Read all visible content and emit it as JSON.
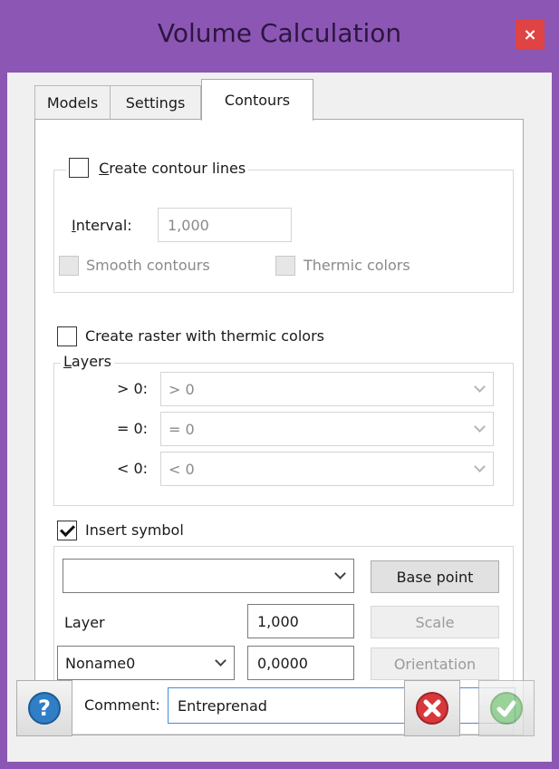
{
  "window": {
    "title": "Volume Calculation",
    "close_label": "×",
    "frame_color": "#8c57b4"
  },
  "tabs": [
    {
      "label": "Models",
      "active": false
    },
    {
      "label": "Settings",
      "active": false
    },
    {
      "label": "Contours",
      "active": true
    }
  ],
  "contour_lines": {
    "checkbox_label_hotkey": "C",
    "checkbox_label_rest": "reate contour lines",
    "checked": false,
    "interval_label_hotkey": "I",
    "interval_label_rest": "nterval:",
    "interval_value": "1,000",
    "smooth_label": "Smooth contours",
    "thermic_label": "Thermic colors"
  },
  "raster": {
    "checkbox_label": "Create raster with thermic colors",
    "checked": false
  },
  "layers": {
    "legend_hotkey": "L",
    "legend_rest": "ayers",
    "rows": [
      {
        "label": "> 0:",
        "value": "> 0"
      },
      {
        "label": "= 0:",
        "value": "= 0"
      },
      {
        "label": "< 0:",
        "value": "< 0"
      }
    ]
  },
  "symbol": {
    "checkbox_label": "Insert symbol",
    "checked": true,
    "symbol_select_value": "",
    "base_point_label": "Base point",
    "layer_label": "Layer",
    "scale_value": "1,000",
    "scale_button": "Scale",
    "layer_select_value": "Noname0",
    "orientation_value": "0,0000",
    "orientation_button": "Orientation",
    "comment_label": "Comment:",
    "comment_value": "Entreprenad"
  },
  "footer": {
    "help_icon": "help-icon",
    "cancel_icon": "cancel-icon",
    "ok_icon": "ok-icon",
    "cancel_color": "#d8383b",
    "ok_color": "#57b957",
    "help_color": "#2f7ec6"
  }
}
